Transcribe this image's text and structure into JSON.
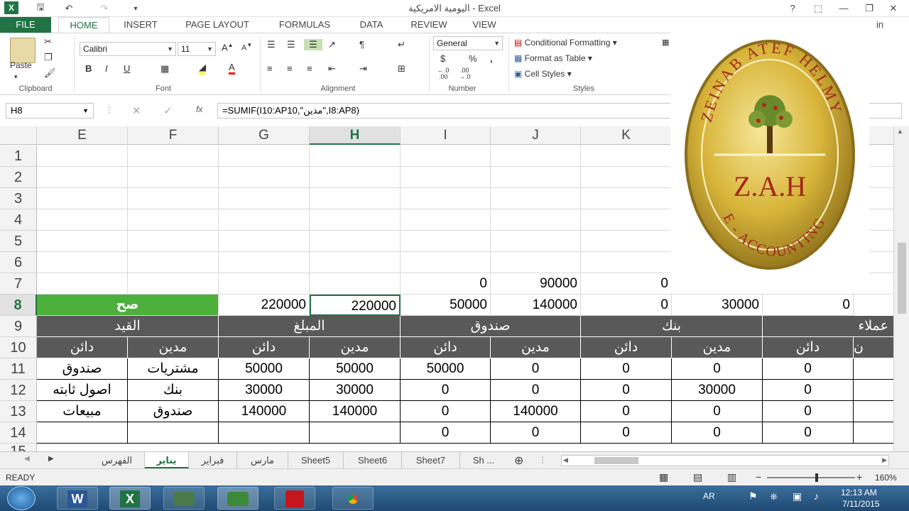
{
  "window": {
    "title": "اليومية الامريكية - Excel",
    "help": "?",
    "minimize": "—",
    "restore": "❐",
    "close": "✕"
  },
  "ribbon_tabs": [
    "FILE",
    "HOME",
    "INSERT",
    "PAGE LAYOUT",
    "FORMULAS",
    "DATA",
    "REVIEW",
    "VIEW"
  ],
  "signin": "in",
  "clipboard": {
    "paste": "Paste",
    "label": "Clipboard"
  },
  "font": {
    "name": "Calibri",
    "size": "11",
    "label": "Font",
    "bold": "B",
    "italic": "I",
    "underline": "U"
  },
  "alignment": {
    "label": "Alignment"
  },
  "number": {
    "format": "General",
    "label": "Number",
    "currency": "$",
    "percent": "%",
    "comma": ",",
    "inc": "←.0\n.00",
    "dec": ".00\n→.0"
  },
  "styles": {
    "conditional": "Conditional Formatting",
    "table": "Format as Table",
    "cell": "Cell Styles",
    "label": "Styles"
  },
  "formula_bar": {
    "namebox": "H8",
    "fx": "fx",
    "formula": "=SUMIF(I10:AP10,\"مدين\",I8:AP8)"
  },
  "columns": [
    "E",
    "F",
    "G",
    "H",
    "I",
    "J",
    "K"
  ],
  "rows": [
    "1",
    "2",
    "3",
    "4",
    "5",
    "6",
    "7",
    "8",
    "9",
    "10",
    "11",
    "12",
    "13",
    "14",
    "15"
  ],
  "cells": {
    "r7": {
      "I": "0",
      "J": "90000",
      "K": "0"
    },
    "r8": {
      "EF": "صح",
      "G": "220000",
      "H": "220000",
      "I": "50000",
      "J": "140000",
      "K": "0",
      "L": "30000",
      "M": "0"
    },
    "r9": {
      "EF": "القيد",
      "GH": "المبلغ",
      "IJ": "صندوق",
      "KL": "بنك",
      "M": "عملاء"
    },
    "r10": {
      "E": "دائن",
      "F": "مدين",
      "G": "دائن",
      "H": "مدين",
      "I": "دائن",
      "J": "مدين",
      "K": "دائن",
      "L": "مدين",
      "M": "دائن",
      "N": "ن"
    },
    "r11": {
      "E": "صندوق",
      "F": "مشتريات",
      "G": "50000",
      "H": "50000",
      "I": "50000",
      "J": "0",
      "K": "0",
      "L": "0",
      "M": "0"
    },
    "r12": {
      "E": "اصول ثابته",
      "F": "بنك",
      "G": "30000",
      "H": "30000",
      "I": "0",
      "J": "0",
      "K": "0",
      "L": "30000",
      "M": "0"
    },
    "r13": {
      "E": "مبيعات",
      "F": "صندوق",
      "G": "140000",
      "H": "140000",
      "I": "0",
      "J": "140000",
      "K": "0",
      "L": "0",
      "M": "0"
    },
    "r14": {
      "I": "0",
      "J": "0",
      "K": "0",
      "L": "0",
      "M": "0"
    }
  },
  "sheets": [
    "الفهرس",
    "يناير",
    "فبراير",
    "مارس",
    "Sheet5",
    "Sheet6",
    "Sheet7",
    "Sh ..."
  ],
  "status": {
    "ready": "READY",
    "zoom": "160%"
  },
  "logo": {
    "top_text": "ZEINAB ATEF HELMY",
    "middle": "Z.A.H",
    "bottom_text": "E - ACCOUNTING",
    "colors": {
      "gold": "#c9a227",
      "dark_gold": "#8a6d1a",
      "red": "#a3271d"
    }
  },
  "taskbar": {
    "lang": "AR",
    "time": "12:13 AM",
    "date": "7/11/2015"
  }
}
